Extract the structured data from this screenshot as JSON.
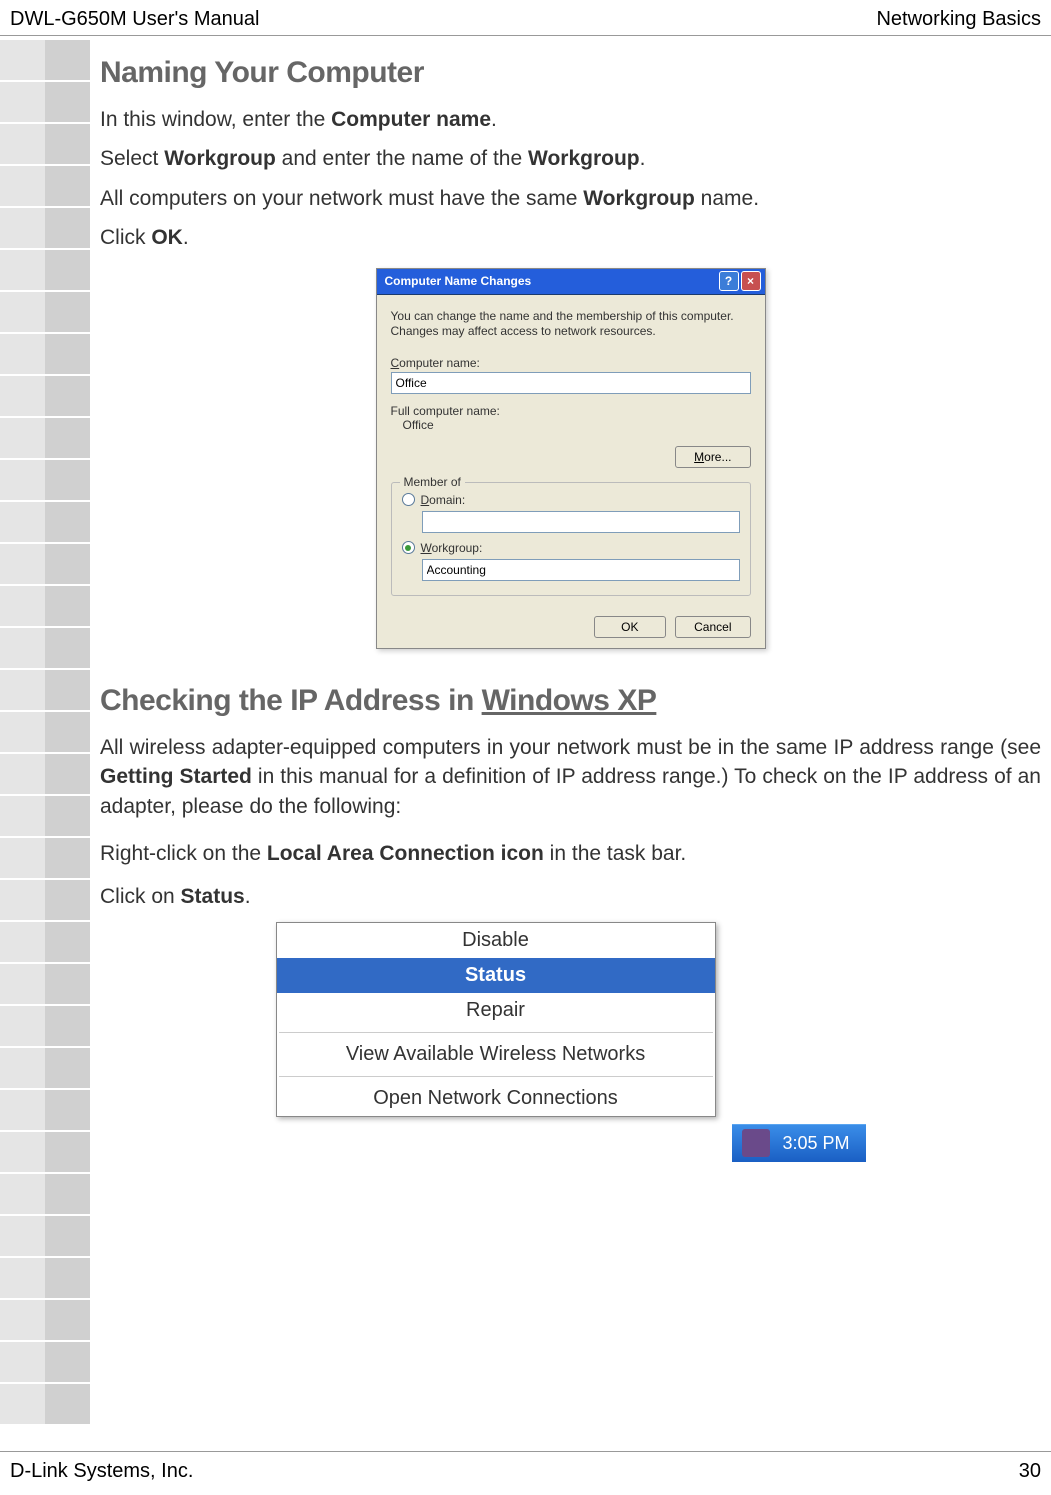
{
  "header": {
    "left": "DWL-G650M User's Manual",
    "right": "Networking Basics"
  },
  "section1": {
    "title": "Naming Your Computer",
    "line1_pre": "In this window, enter the ",
    "line1_bold": "Computer name",
    "line1_post": ".",
    "line2_pre": "Select ",
    "line2_b1": "Workgroup",
    "line2_mid": " and enter the name of the ",
    "line2_b2": "Workgroup",
    "line2_post": ".",
    "line3_pre": "All computers on your network must have the same ",
    "line3_b": "Workgroup",
    "line3_post": " name.",
    "line4_pre": "Click ",
    "line4_b": "OK",
    "line4_post": "."
  },
  "dialog": {
    "title": "Computer Name Changes",
    "desc": "You can change the name and the membership of this computer. Changes may affect access to network resources.",
    "computer_name_label": "Computer name:",
    "computer_name_value": "Office",
    "full_name_label": "Full computer name:",
    "full_name_value": "Office",
    "more_btn": "More...",
    "member_of": "Member of",
    "domain_label": "Domain:",
    "domain_value": "",
    "workgroup_label": "Workgroup:",
    "workgroup_value": "Accounting",
    "ok_btn": "OK",
    "cancel_btn": "Cancel"
  },
  "section2": {
    "title_pre": "Checking the IP Address in ",
    "title_u": "Windows XP",
    "para1_pre": "All wireless adapter-equipped computers in your network must be in the same IP address range (see ",
    "para1_b": "Getting Started",
    "para1_post": " in this manual for a definition of IP address range.) To check on the IP address of an adapter, please do the following:",
    "line2_pre": "Right-click on the ",
    "line2_b": "Local Area Connection icon",
    "line2_post": " in the task bar.",
    "line3_pre": "Click on ",
    "line3_b": "Status",
    "line3_post": "."
  },
  "context_menu": {
    "items": [
      "Disable",
      "Status",
      "Repair",
      "View Available Wireless Networks",
      "Open Network Connections"
    ],
    "highlighted_index": 1
  },
  "clock": "3:05 PM",
  "footer": {
    "left": "D-Link Systems, Inc.",
    "right": "30"
  }
}
